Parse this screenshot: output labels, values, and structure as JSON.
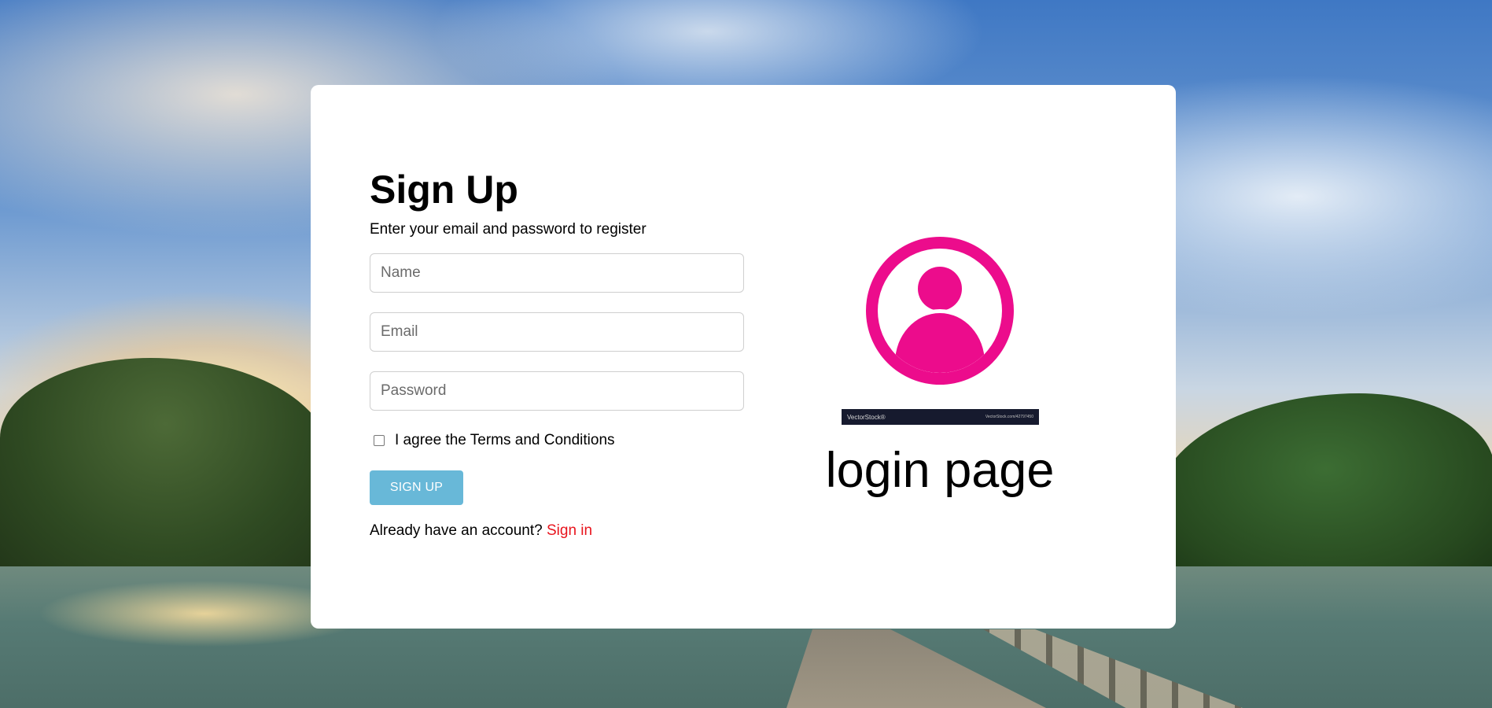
{
  "signup": {
    "title": "Sign Up",
    "subtitle": "Enter your email and password to register",
    "fields": {
      "name": {
        "placeholder": "Name",
        "value": ""
      },
      "email": {
        "placeholder": "Email",
        "value": ""
      },
      "password": {
        "placeholder": "Password",
        "value": ""
      }
    },
    "terms": {
      "label": "I agree the Terms and Conditions",
      "checked": false
    },
    "submit_label": "SIGN UP",
    "account_prompt": "Already have an account?",
    "signin_link": "Sign in",
    "colors": {
      "button": "#68b8d8",
      "link": "#e8141d"
    }
  },
  "illustration": {
    "icon": "user-avatar-icon",
    "icon_color": "#ec0c8c",
    "watermark_brand": "VectorStock®",
    "watermark_url": "VectorStock.com/42797450",
    "caption": "login page"
  }
}
